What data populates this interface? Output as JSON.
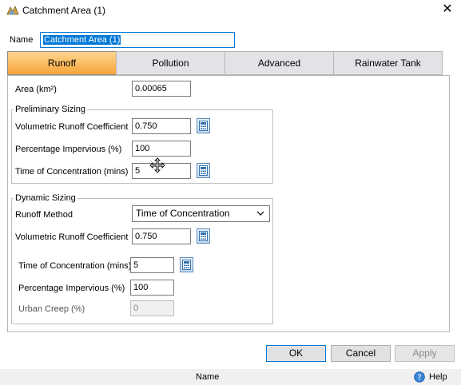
{
  "window": {
    "title": "Catchment Area (1)"
  },
  "name_field": {
    "label": "Name",
    "value": "Catchment Area (1)"
  },
  "tabs": [
    {
      "label": "Runoff",
      "active": true
    },
    {
      "label": "Pollution",
      "active": false
    },
    {
      "label": "Advanced",
      "active": false
    },
    {
      "label": "Rainwater Tank",
      "active": false
    }
  ],
  "runoff": {
    "area": {
      "label": "Area (km²)",
      "value": "0.00065"
    },
    "preliminary": {
      "title": "Preliminary Sizing",
      "vrc": {
        "label": "Volumetric Runoff Coefficient",
        "value": "0.750"
      },
      "impervious": {
        "label": "Percentage Impervious (%)",
        "value": "100"
      },
      "toc": {
        "label": "Time of Concentration (mins)",
        "value": "5"
      }
    },
    "dynamic": {
      "title": "Dynamic Sizing",
      "method": {
        "label": "Runoff Method",
        "value": "Time of Concentration"
      },
      "vrc": {
        "label": "Volumetric Runoff Coefficient",
        "value": "0.750"
      },
      "toc": {
        "label": "Time of Concentration (mins)",
        "value": "5"
      },
      "impervious": {
        "label": "Percentage Impervious (%)",
        "value": "100"
      },
      "urban_creep": {
        "label": "Urban Creep (%)",
        "value": "0"
      }
    }
  },
  "buttons": {
    "ok": "OK",
    "cancel": "Cancel",
    "apply": "Apply"
  },
  "statusbar": {
    "text": "Name",
    "help": "Help"
  },
  "colors": {
    "active_tab": "#f7a53a",
    "selection": "#0078d7",
    "calc_icon": "#2f6fb0"
  },
  "icons": [
    "app-icon",
    "close-icon",
    "calculator-icon",
    "chevron-down-icon",
    "help-icon",
    "move-cursor-icon"
  ]
}
